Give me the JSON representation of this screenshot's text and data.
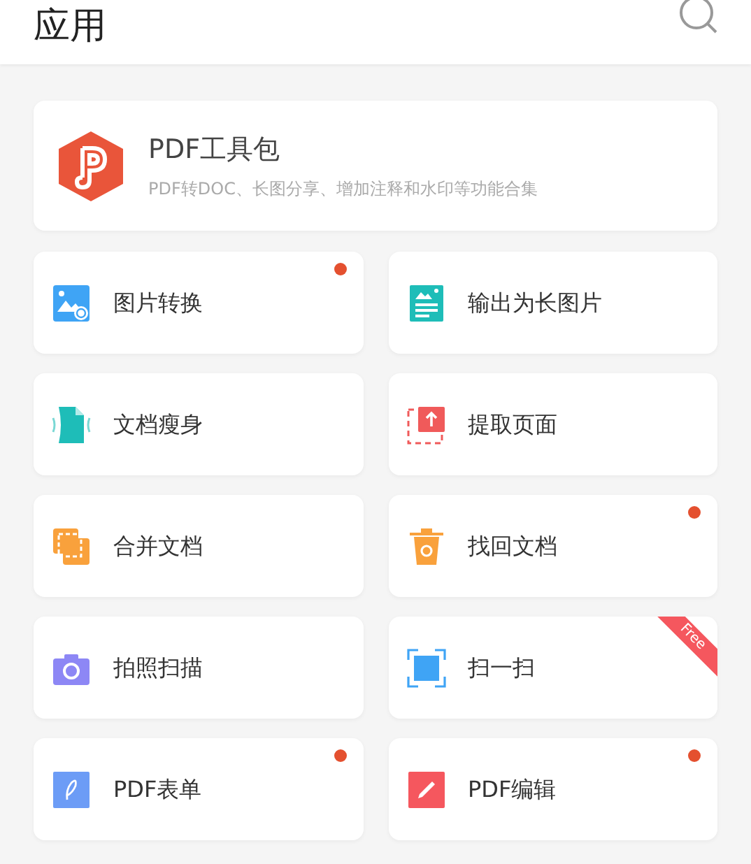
{
  "header": {
    "title": "应用"
  },
  "featured": {
    "title": "PDF工具包",
    "subtitle": "PDF转DOC、长图分享、增加注释和水印等功能合集"
  },
  "tools": [
    {
      "kind": "imageconvert",
      "label": "图片转换",
      "new": true
    },
    {
      "kind": "longimage",
      "label": "输出为长图片",
      "new": false
    },
    {
      "kind": "slim",
      "label": "文档瘦身",
      "new": false
    },
    {
      "kind": "extract",
      "label": "提取页面",
      "new": false
    },
    {
      "kind": "merge",
      "label": "合并文档",
      "new": false
    },
    {
      "kind": "recover",
      "label": "找回文档",
      "new": true
    },
    {
      "kind": "camera",
      "label": "拍照扫描",
      "new": false
    },
    {
      "kind": "scan",
      "label": "扫一扫",
      "new": false,
      "ribbon": "Free"
    },
    {
      "kind": "form",
      "label": "PDF表单",
      "new": true
    },
    {
      "kind": "edit",
      "label": "PDF编辑",
      "new": true
    }
  ]
}
